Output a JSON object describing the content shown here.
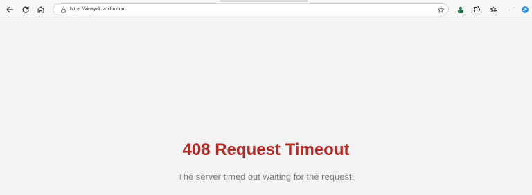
{
  "browser": {
    "url": "https://vinayak.voxfor.com",
    "icons": {
      "back": "back-arrow-icon",
      "refresh": "refresh-icon",
      "home": "home-icon",
      "lock": "lock-icon",
      "favorite": "star-icon",
      "profile": "profile-icon",
      "extensions": "extensions-icon",
      "collections": "favorites-collection-icon",
      "menu": "more-menu-icon",
      "copilot": "copilot-icon"
    },
    "menu_label": "···"
  },
  "page": {
    "title": "408 Request Timeout",
    "message": "The server timed out waiting for the request."
  },
  "colors": {
    "title": "#b12a24",
    "message": "#7c7c7c",
    "background": "#f3f3f3"
  }
}
